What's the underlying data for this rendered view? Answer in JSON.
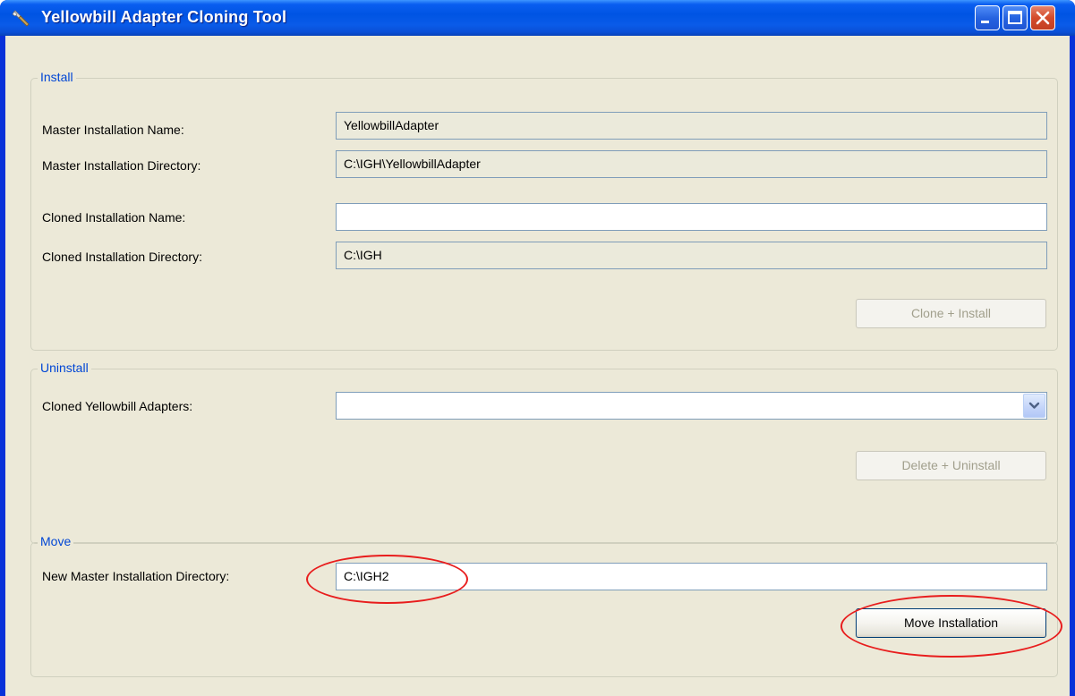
{
  "window": {
    "title": "Yellowbill Adapter Cloning Tool"
  },
  "install": {
    "legend": "Install",
    "master_name_label": "Master Installation Name:",
    "master_name_value": "YellowbillAdapter",
    "master_dir_label": "Master Installation Directory:",
    "master_dir_value": "C:\\IGH\\YellowbillAdapter",
    "cloned_name_label": "Cloned Installation Name:",
    "cloned_name_value": "",
    "cloned_dir_label": "Cloned Installation Directory:",
    "cloned_dir_value": "C:\\IGH",
    "clone_button": "Clone + Install"
  },
  "uninstall": {
    "legend": "Uninstall",
    "adapters_label": "Cloned Yellowbill Adapters:",
    "adapters_selected": "",
    "delete_button": "Delete + Uninstall"
  },
  "move": {
    "legend": "Move",
    "new_dir_label": "New Master Installation Directory:",
    "new_dir_value": "C:\\IGH2",
    "move_button": "Move Installation"
  },
  "colors": {
    "title_bar": "#0054e3",
    "window_bg": "#ece9d8",
    "group_legend": "#0046d5",
    "highlight_ellipse": "#e81d1d"
  },
  "icons": [
    "app-icon",
    "minimize-icon",
    "maximize-icon",
    "close-icon",
    "chevron-down-icon"
  ]
}
